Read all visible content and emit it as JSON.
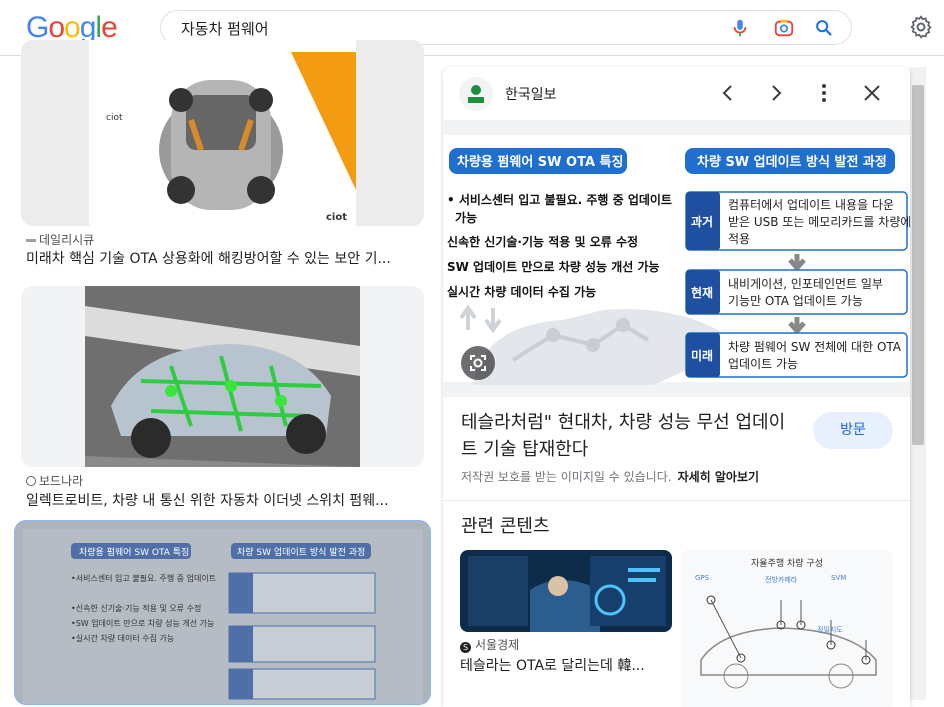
{
  "search": {
    "query": "자동차 펌웨어"
  },
  "results": [
    {
      "source": "데일리시큐",
      "title": "미래차 핵심 기술 OTA 상용화에 해킹방어할 수 있는 보안 기..."
    },
    {
      "source": "보드나라",
      "title": "일렉트로비트, 차량 내 통신 위한 자동차 이더넷 스위치 펌웨..."
    },
    {
      "source": "",
      "title": ""
    }
  ],
  "panel": {
    "source_name": "한국일보",
    "description": "테슬라처럼\" 현대차, 차량 성능 무선 업데이트 기술 탑재한다",
    "visit_label": "방문",
    "copyright": "저작권 보호를 받는 이미지일 수 있습니다.",
    "learn_more": "자세히 알아보기",
    "related_title": "관련 콘텐츠",
    "related": [
      {
        "source": "서울경제",
        "title": "테슬라는 OTA로 달리는데 韓..."
      },
      {
        "source": "",
        "title": ""
      }
    ],
    "infographic": {
      "left_title": "차량용 펌웨어 SW OTA 특징",
      "bullets": [
        "서비스센터 입고 불필요. 주행 중 업데이트 가능",
        "신속한 신기술·기능 적용 및 오류 수정",
        "SW 업데이트 만으로 차량 성능 개선 가능",
        "실시간 차량 데이터 수집 가능"
      ],
      "right_title": "차량 SW 업데이트 방식 발전 과정",
      "stages": [
        {
          "label": "과거",
          "text": "컴퓨터에서 업데이트 내용을 다운 받은 USB 또는 메모리카드를 차량에 적용"
        },
        {
          "label": "현재",
          "text": "내비게이션, 인포테인먼트 일부 기능만 OTA 업데이트 가능"
        },
        {
          "label": "미래",
          "text": "차량 펌웨어 SW 전체에 대한 OTA 업데이트 가능"
        }
      ]
    },
    "related_image_title": "자율주행 차량 구성"
  },
  "colors": {
    "accent": "#1a73e8",
    "infographic_blue": "#1f5fbf",
    "infographic_dark": "#0b3d91"
  }
}
